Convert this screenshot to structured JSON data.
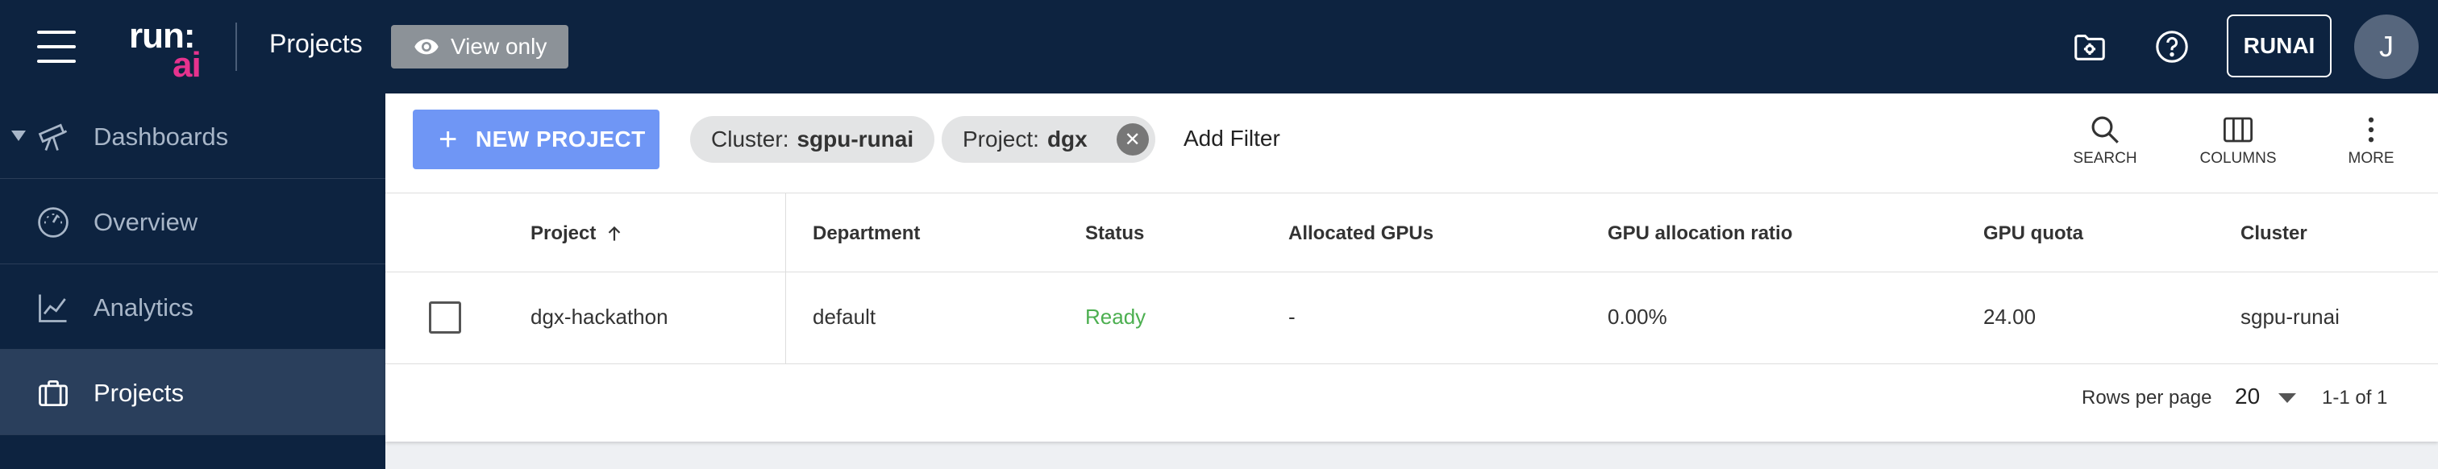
{
  "header": {
    "logo_top": "run:",
    "logo_bottom": "ai",
    "title": "Projects",
    "view_only_label": "View only",
    "user_button": "RUNAI",
    "avatar_initial": "J",
    "icons": [
      "menu-icon",
      "folder-settings-icon",
      "help-icon"
    ]
  },
  "sidebar": {
    "items": [
      {
        "label": "Dashboards",
        "icon": "telescope-icon"
      },
      {
        "label": "Overview",
        "icon": "speedometer-icon"
      },
      {
        "label": "Analytics",
        "icon": "line-chart-icon"
      },
      {
        "label": "Projects",
        "icon": "briefcase-icon",
        "active": true
      }
    ]
  },
  "toolbar": {
    "new_project": "NEW PROJECT",
    "filters": [
      {
        "key": "Cluster:",
        "value": "sgpu-runai"
      },
      {
        "key": "Project:",
        "value": "dgx"
      }
    ],
    "add_filter": "Add Filter",
    "search": "SEARCH",
    "columns": "COLUMNS",
    "more": "MORE"
  },
  "table": {
    "columns": [
      "Project",
      "Department",
      "Status",
      "Allocated GPUs",
      "GPU allocation ratio",
      "GPU quota",
      "Cluster"
    ],
    "sort_column": "Project",
    "sort_direction": "ascending",
    "rows": [
      [
        "dgx-hackathon",
        "default",
        "Ready",
        "-",
        "0.00%",
        "24.00",
        "sgpu-runai"
      ]
    ]
  },
  "pagination": {
    "rows_per_page_label": "Rows per page",
    "rows_per_page": "20",
    "range": "1-1 of 1"
  },
  "colors": {
    "header_bg": "#0d2340",
    "accent": "#6f96f5",
    "brand_pink": "#e6338e",
    "status_ready": "#4caf50"
  }
}
